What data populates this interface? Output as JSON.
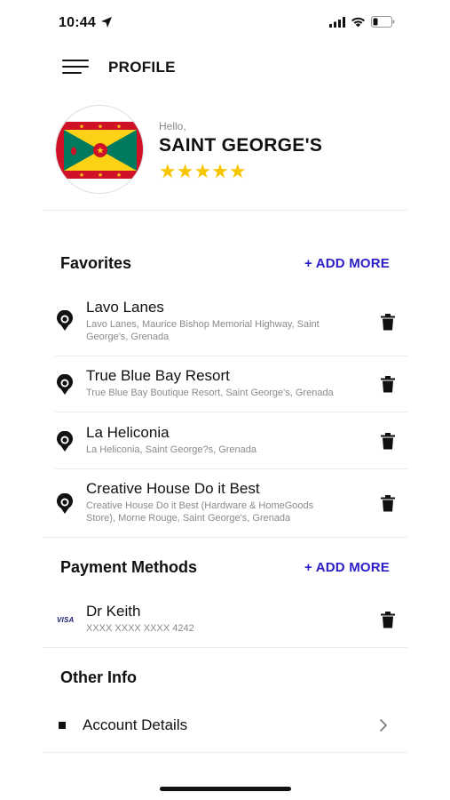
{
  "status_bar": {
    "time": "10:44"
  },
  "header": {
    "title": "PROFILE"
  },
  "profile": {
    "greeting": "Hello,",
    "name": "SAINT GEORGE'S",
    "rating": 5,
    "stars_text": "★★★★★"
  },
  "favorites": {
    "title": "Favorites",
    "add_label": "+ ADD MORE",
    "items": [
      {
        "name": "Lavo Lanes",
        "address_line1": "Lavo Lanes, Maurice Bishop Memorial Highway, Saint",
        "address_line2": "George's, Grenada"
      },
      {
        "name": "True Blue Bay Resort",
        "address_line1": "True Blue Bay Boutique Resort, Saint George's, Grenada",
        "address_line2": ""
      },
      {
        "name": "La Heliconia",
        "address_line1": "La Heliconia, Saint George?s, Grenada",
        "address_line2": ""
      },
      {
        "name": "Creative House Do it Best",
        "address_line1": "Creative House Do it Best (Hardware & HomeGoods",
        "address_line2": "Store), Morne Rouge, Saint George's, Grenada"
      }
    ]
  },
  "payment": {
    "title": "Payment Methods",
    "add_label": "+ ADD MORE",
    "card": {
      "brand": "VISA",
      "holder": "Dr Keith",
      "number": "XXXX XXXX XXXX 4242"
    }
  },
  "other": {
    "title": "Other Info",
    "account_label": "Account Details"
  },
  "colors": {
    "accent": "#2b1dc7",
    "star": "#f7c600"
  }
}
